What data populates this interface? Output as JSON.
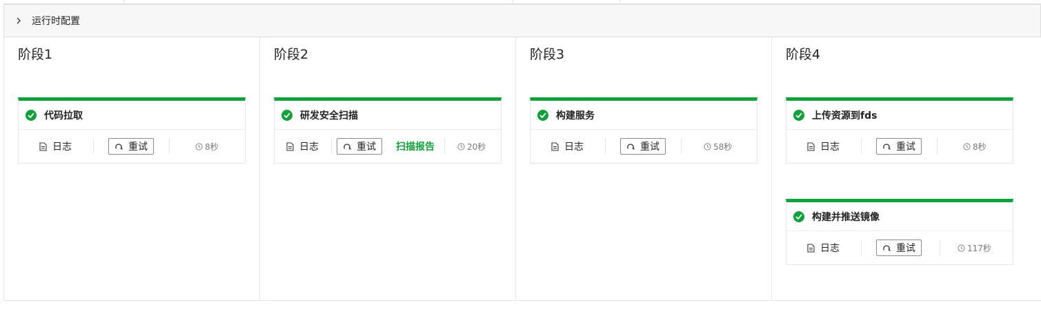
{
  "runtime_config": {
    "label": "运行时配置"
  },
  "stages": [
    {
      "title": "阶段1",
      "jobs": [
        {
          "name": "代码拉取",
          "log_label": "日志",
          "retry_label": "重试",
          "duration": "8秒",
          "status": "success"
        }
      ]
    },
    {
      "title": "阶段2",
      "jobs": [
        {
          "name": "研发安全扫描",
          "log_label": "日志",
          "retry_label": "重试",
          "report_label": "扫描报告",
          "duration": "20秒",
          "status": "success"
        }
      ]
    },
    {
      "title": "阶段3",
      "jobs": [
        {
          "name": "构建服务",
          "log_label": "日志",
          "retry_label": "重试",
          "duration": "58秒",
          "status": "success"
        }
      ]
    },
    {
      "title": "阶段4",
      "jobs": [
        {
          "name": "上传资源到fds",
          "log_label": "日志",
          "retry_label": "重试",
          "duration": "8秒",
          "status": "success"
        },
        {
          "name": "构建并推送镜像",
          "log_label": "日志",
          "retry_label": "重试",
          "duration": "117秒",
          "status": "success"
        }
      ]
    }
  ],
  "colors": {
    "success": "#11a13b",
    "report_link": "#11a13b"
  },
  "icons": {
    "expand": "chevron-right-icon",
    "status": "check-circle-icon",
    "log": "document-icon",
    "retry": "refresh-icon",
    "duration": "clock-icon"
  }
}
